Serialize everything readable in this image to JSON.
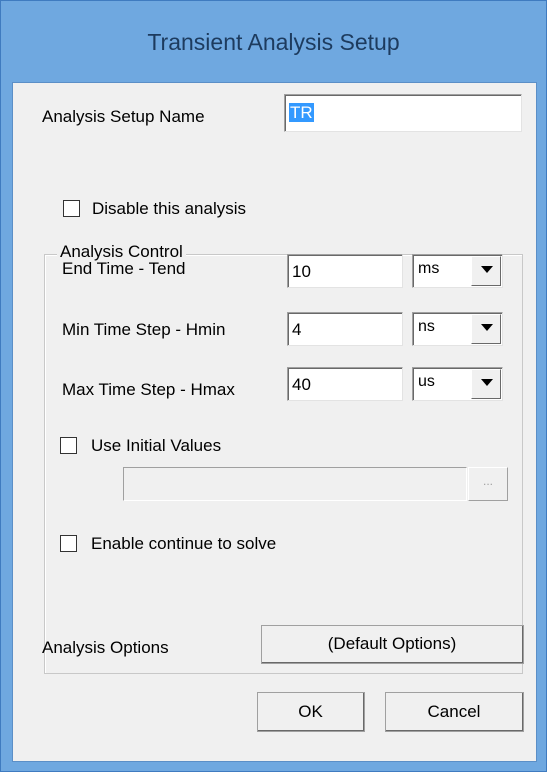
{
  "window": {
    "title": "Transient Analysis Setup"
  },
  "setup_name": {
    "label": "Analysis Setup Name",
    "value": "TR"
  },
  "analysis_control": {
    "legend": "Analysis Control",
    "disable": {
      "label": "Disable this analysis",
      "checked": false
    },
    "end_time": {
      "label": "End Time - Tend",
      "value": "10",
      "unit": "ms"
    },
    "min_step": {
      "label": "Min Time Step - Hmin",
      "value": "4",
      "unit": "ns"
    },
    "max_step": {
      "label": "Max Time Step - Hmax",
      "value": "40",
      "unit": "us"
    },
    "initial_values": {
      "label": "Use Initial Values",
      "checked": false,
      "path_value": "",
      "browse_label": "..."
    },
    "continue_solve": {
      "label": "Enable continue to solve",
      "checked": false
    }
  },
  "options": {
    "label": "Analysis Options",
    "button": "(Default Options)"
  },
  "buttons": {
    "ok": "OK",
    "cancel": "Cancel"
  }
}
